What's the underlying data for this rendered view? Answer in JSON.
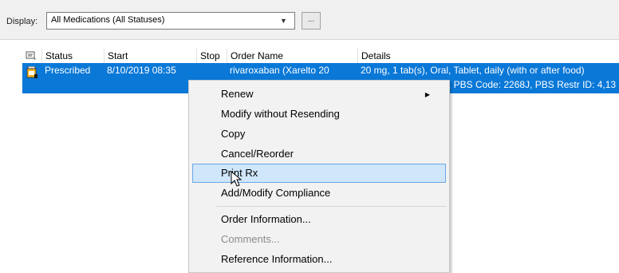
{
  "display": {
    "label": "Display:",
    "selected": "All Medications (All Statuses)",
    "more_button": "..."
  },
  "grid": {
    "columns": [
      "Status",
      "Start",
      "Stop",
      "Order Name",
      "Details"
    ],
    "rows": [
      {
        "status": "Prescribed",
        "start": "8/10/2019 08:35",
        "stop": "",
        "order_name": "rivaroxaban (Xarelto 20",
        "details_line1": "20 mg, 1 tab(s), Oral, Tablet, daily (with or after food)",
        "details_line2": ", PBS Code: 2268J, PBS Restr ID: 4,13"
      }
    ]
  },
  "context_menu": {
    "items": [
      {
        "label": "Renew",
        "submenu": true
      },
      {
        "label": "Modify without Resending"
      },
      {
        "label": "Copy"
      },
      {
        "label": "Cancel/Reorder"
      },
      {
        "label": "Print Rx",
        "highlighted": true
      },
      {
        "label": "Add/Modify Compliance"
      },
      {
        "label": "Order Information..."
      },
      {
        "label": "Comments...",
        "disabled": true
      },
      {
        "label": "Reference Information..."
      }
    ]
  },
  "colors": {
    "selection": "#0a78d7",
    "menu_highlight": "#cfe6fb"
  }
}
